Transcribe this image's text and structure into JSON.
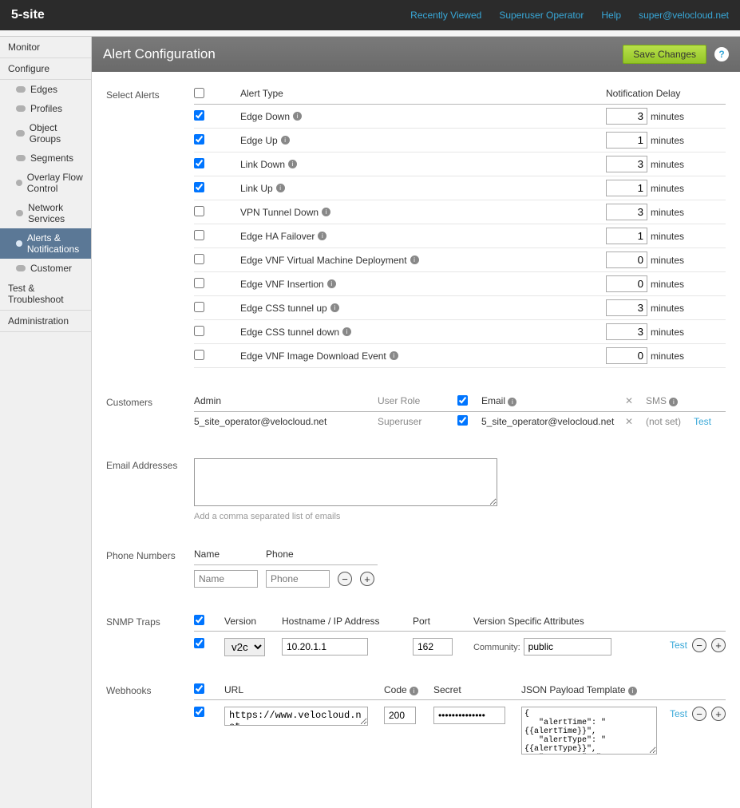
{
  "topbar": {
    "logo": "5-site",
    "links": [
      "Recently Viewed",
      "Superuser Operator",
      "Help",
      "super@velocloud.net"
    ]
  },
  "sidebar": {
    "groups": [
      {
        "label": "Monitor",
        "items": []
      },
      {
        "label": "Configure",
        "items": [
          {
            "label": "Edges"
          },
          {
            "label": "Profiles"
          },
          {
            "label": "Object Groups"
          },
          {
            "label": "Segments"
          },
          {
            "label": "Overlay Flow Control"
          },
          {
            "label": "Network Services"
          },
          {
            "label": "Alerts & Notifications",
            "active": true
          },
          {
            "label": "Customer"
          }
        ]
      },
      {
        "label": "Test & Troubleshoot",
        "items": []
      },
      {
        "label": "Administration",
        "items": []
      }
    ]
  },
  "page": {
    "title": "Alert Configuration",
    "save": "Save Changes"
  },
  "alerts": {
    "section_label": "Select Alerts",
    "head_type": "Alert Type",
    "head_delay": "Notification Delay",
    "unit": "minutes",
    "rows": [
      {
        "checked": true,
        "label": "Edge Down",
        "info": true,
        "delay": "3"
      },
      {
        "checked": true,
        "label": "Edge Up",
        "info": true,
        "delay": "1"
      },
      {
        "checked": true,
        "label": "Link Down",
        "info": true,
        "delay": "3"
      },
      {
        "checked": true,
        "label": "Link Up",
        "info": true,
        "delay": "1"
      },
      {
        "checked": false,
        "label": "VPN Tunnel Down",
        "info": true,
        "delay": "3"
      },
      {
        "checked": false,
        "label": "Edge HA Failover",
        "info": true,
        "delay": "1"
      },
      {
        "checked": false,
        "label": "Edge VNF Virtual Machine Deployment",
        "info": true,
        "delay": "0"
      },
      {
        "checked": false,
        "label": "Edge VNF Insertion",
        "info": true,
        "delay": "0"
      },
      {
        "checked": false,
        "label": "Edge CSS tunnel up",
        "info": true,
        "delay": "3"
      },
      {
        "checked": false,
        "label": "Edge CSS tunnel down",
        "info": true,
        "delay": "3"
      },
      {
        "checked": false,
        "label": "Edge VNF Image Download Event",
        "info": true,
        "delay": "0"
      }
    ]
  },
  "customers": {
    "section_label": "Customers",
    "head_admin": "Admin",
    "head_role": "User Role",
    "head_email": "Email",
    "head_sms": "SMS",
    "rows": [
      {
        "admin": "5_site_operator@velocloud.net",
        "role": "Superuser",
        "checked": true,
        "email": "5_site_operator@velocloud.net",
        "sms": "(not set)",
        "test": "Test"
      }
    ]
  },
  "emails": {
    "section_label": "Email Addresses",
    "placeholder": "",
    "hint": "Add a comma separated list of emails"
  },
  "phones": {
    "section_label": "Phone Numbers",
    "head_name": "Name",
    "head_phone": "Phone",
    "name_placeholder": "Name",
    "phone_placeholder": "Phone"
  },
  "snmp": {
    "section_label": "SNMP Traps",
    "enabled": true,
    "head_version": "Version",
    "head_host": "Hostname / IP Address",
    "head_port": "Port",
    "head_attrs": "Version Specific Attributes",
    "row": {
      "checked": true,
      "version": "v2c",
      "host": "10.20.1.1",
      "port": "162",
      "community_label": "Community:",
      "community": "public",
      "test": "Test"
    }
  },
  "webhooks": {
    "section_label": "Webhooks",
    "enabled": true,
    "head_url": "URL",
    "head_code": "Code",
    "head_secret": "Secret",
    "head_template": "JSON Payload Template",
    "row": {
      "checked": true,
      "url": "https://www.velocloud.net",
      "code": "200",
      "secret": "••••••••••••••",
      "template": "{\n   \"alertTime\": \"{{alertTime}}\",\n   \"alertType\": \"{{alertType}}\",\n   \"customer\": \"{{customer}}\",\n   \"entityAffected\": \"{{entityAffected}}\",",
      "test": "Test"
    }
  }
}
